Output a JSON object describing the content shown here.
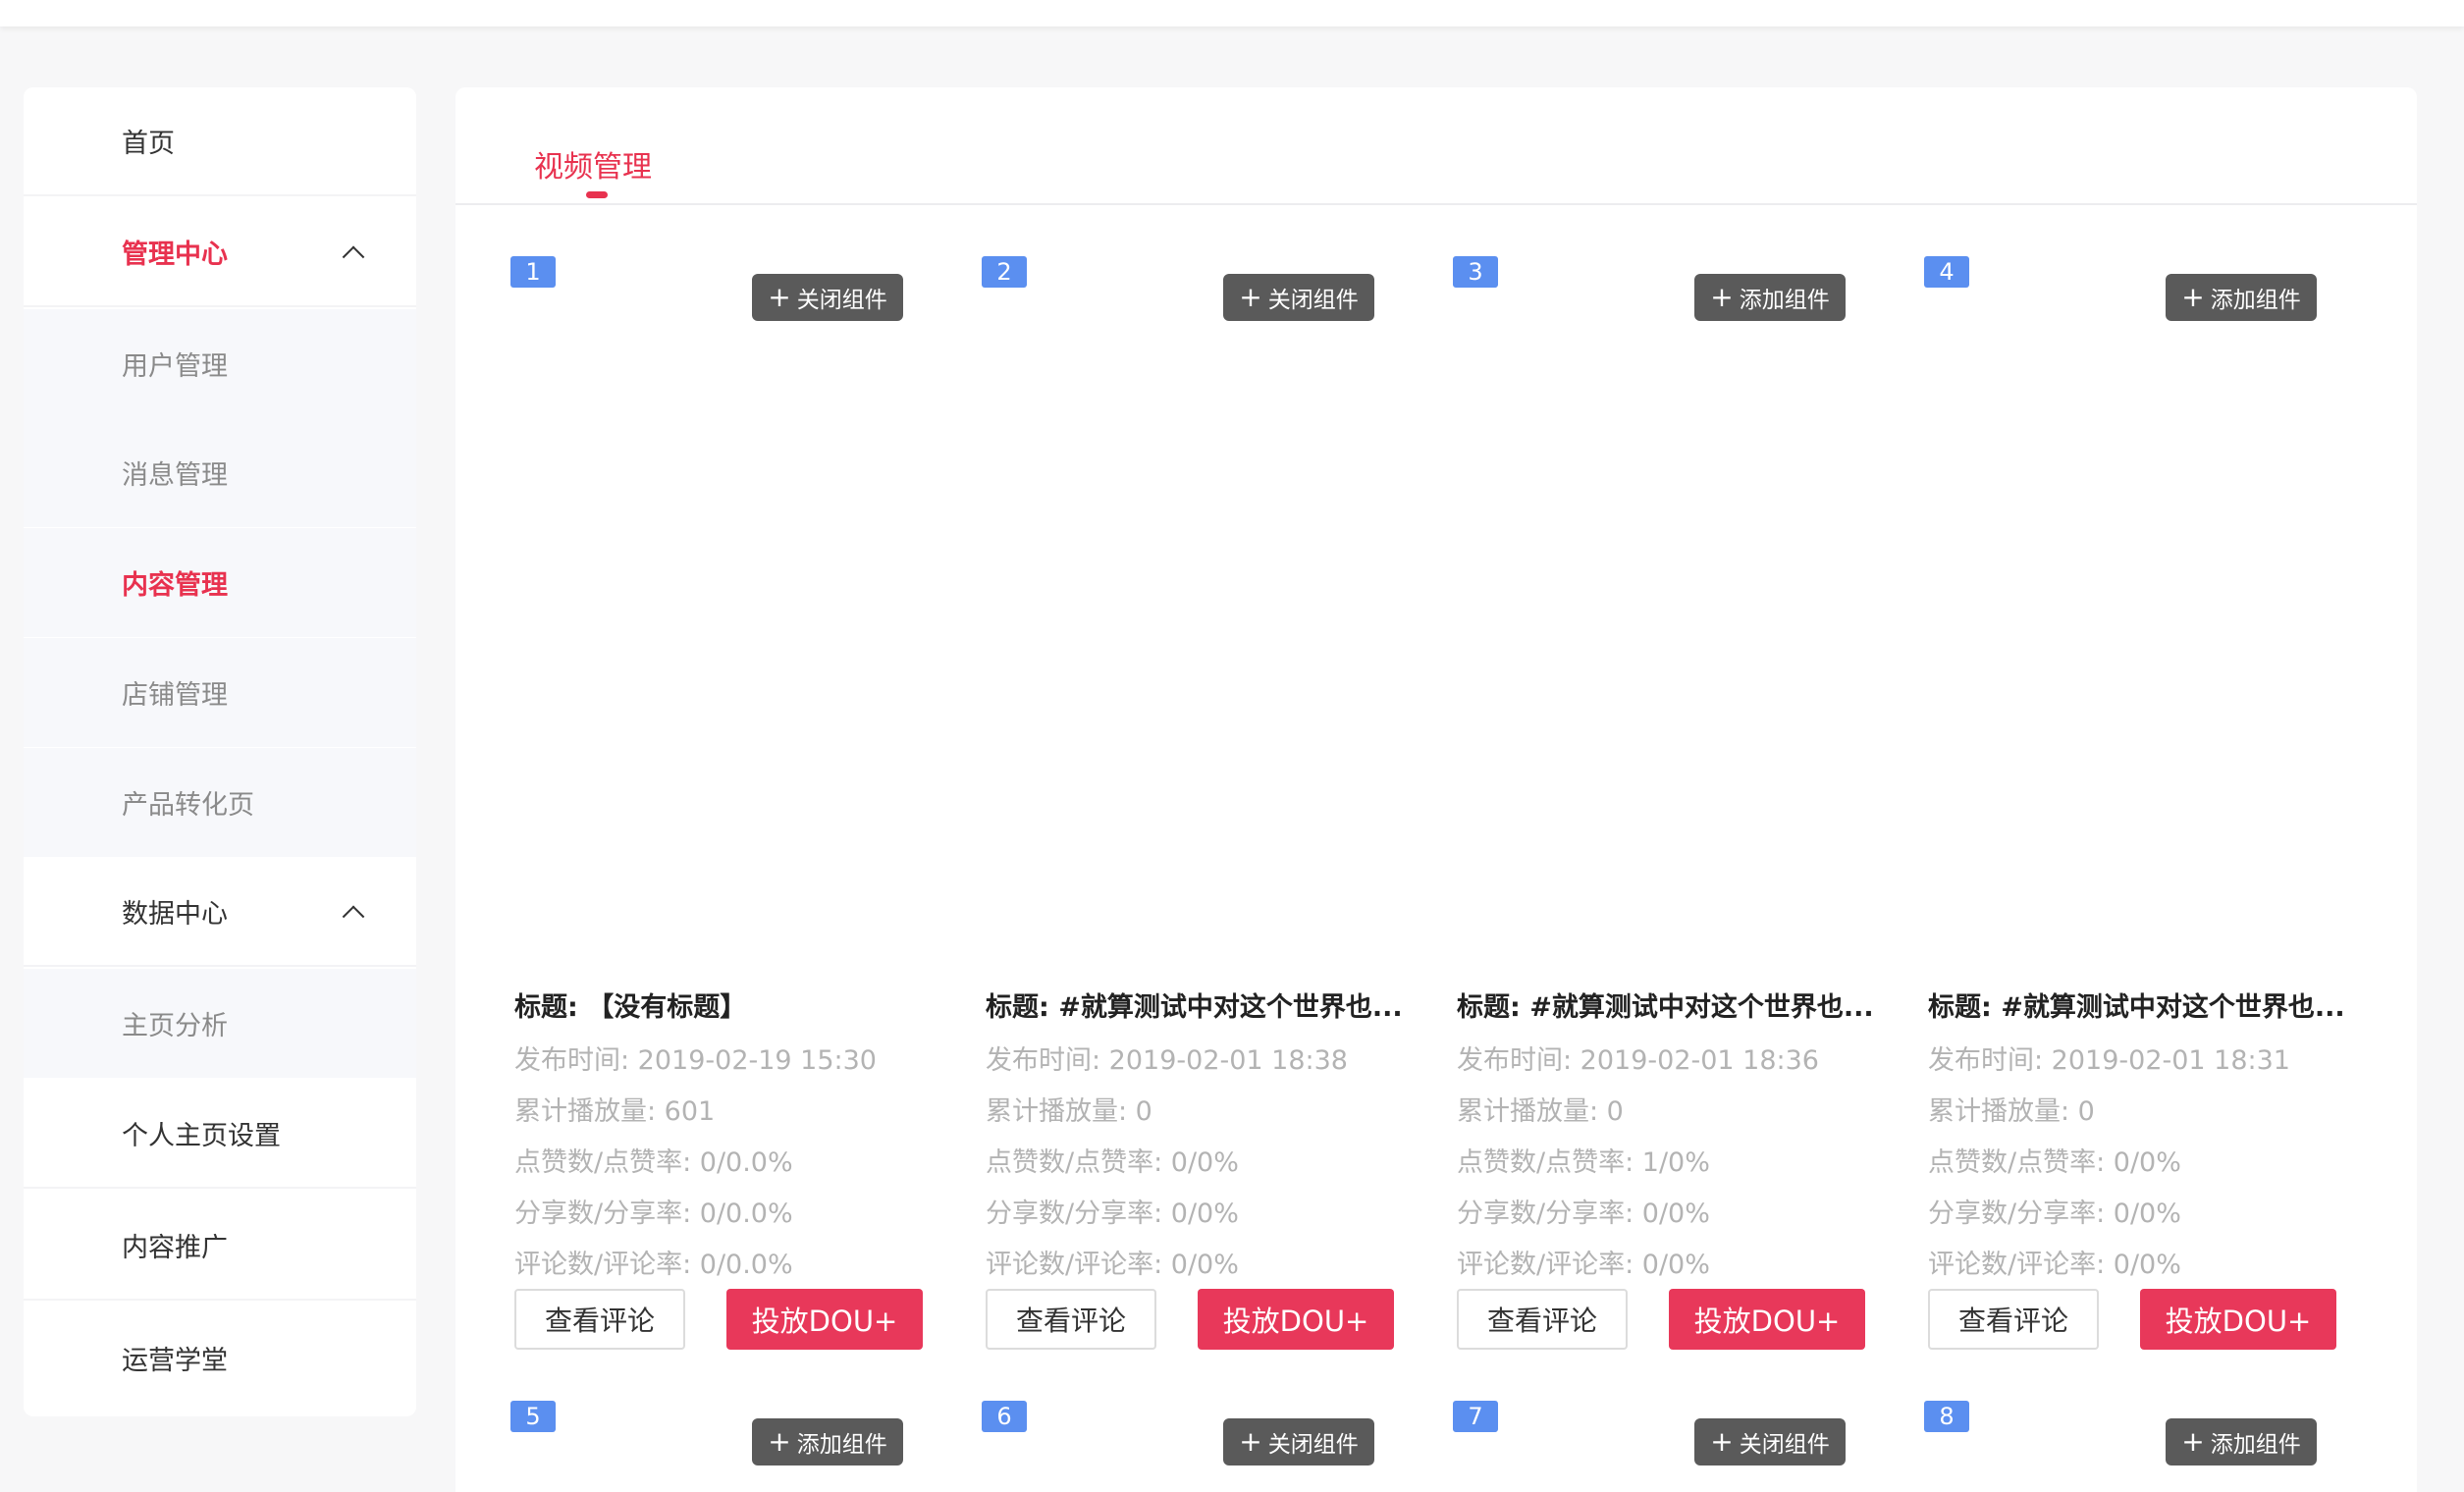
{
  "sidebar": {
    "items": [
      {
        "label": "首页",
        "type": "top"
      },
      {
        "label": "管理中心",
        "type": "group",
        "active": true
      },
      {
        "label": "用户管理",
        "type": "sub"
      },
      {
        "label": "消息管理",
        "type": "sub"
      },
      {
        "label": "内容管理",
        "type": "sub",
        "active": true
      },
      {
        "label": "店铺管理",
        "type": "sub"
      },
      {
        "label": "产品转化页",
        "type": "sub"
      },
      {
        "label": "数据中心",
        "type": "group"
      },
      {
        "label": "主页分析",
        "type": "sub"
      },
      {
        "label": "个人主页设置",
        "type": "top"
      },
      {
        "label": "内容推广",
        "type": "top"
      },
      {
        "label": "运营学堂",
        "type": "top"
      }
    ]
  },
  "tabs": [
    {
      "label": "视频管理",
      "active": true
    }
  ],
  "videos": [
    {
      "index": "1",
      "toggle": "关闭组件",
      "title": "标题: 【没有标题】",
      "publish": "发布时间: 2019-02-19 15:30",
      "plays": "累计播放量: 601",
      "likes": "点赞数/点赞率: 0/0.0%",
      "shares": "分享数/分享率: 0/0.0%",
      "comments": "评论数/评论率: 0/0.0%",
      "view_btn": "查看评论",
      "dou_btn": "投放DOU+"
    },
    {
      "index": "2",
      "toggle": "关闭组件",
      "title": "标题: #就算测试中对这个世界也...",
      "publish": "发布时间: 2019-02-01 18:38",
      "plays": "累计播放量: 0",
      "likes": "点赞数/点赞率: 0/0%",
      "shares": "分享数/分享率: 0/0%",
      "comments": "评论数/评论率: 0/0%",
      "view_btn": "查看评论",
      "dou_btn": "投放DOU+"
    },
    {
      "index": "3",
      "toggle": "添加组件",
      "title": "标题: #就算测试中对这个世界也...",
      "publish": "发布时间: 2019-02-01 18:36",
      "plays": "累计播放量: 0",
      "likes": "点赞数/点赞率: 1/0%",
      "shares": "分享数/分享率: 0/0%",
      "comments": "评论数/评论率: 0/0%",
      "view_btn": "查看评论",
      "dou_btn": "投放DOU+"
    },
    {
      "index": "4",
      "toggle": "添加组件",
      "title": "标题: #就算测试中对这个世界也...",
      "publish": "发布时间: 2019-02-01 18:31",
      "plays": "累计播放量: 0",
      "likes": "点赞数/点赞率: 0/0%",
      "shares": "分享数/分享率: 0/0%",
      "comments": "评论数/评论率: 0/0%",
      "view_btn": "查看评论",
      "dou_btn": "投放DOU+"
    },
    {
      "index": "5",
      "toggle": "添加组件"
    },
    {
      "index": "6",
      "toggle": "关闭组件"
    },
    {
      "index": "7",
      "toggle": "关闭组件"
    },
    {
      "index": "8",
      "toggle": "添加组件"
    }
  ],
  "colors": {
    "accent": "#e8324f",
    "badge": "#5b8ff0",
    "toggle_bg": "#5a5a5a",
    "dou_button": "#e8385a"
  },
  "icons": {
    "group_toggle": "chevron-up-icon",
    "toggle_prefix": "plus-icon"
  }
}
